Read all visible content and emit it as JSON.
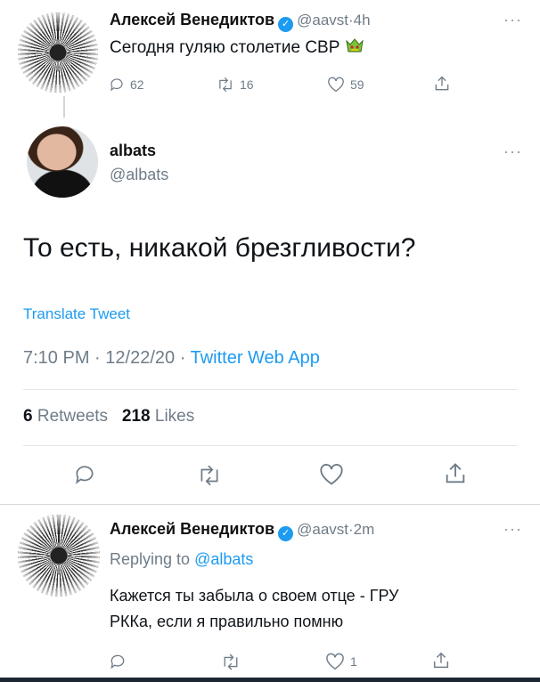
{
  "tweet1": {
    "author_name": "Алексей Венедиктов",
    "handle": "@aavst",
    "time": "4h",
    "text": "Сегодня гуляю столетие СВР",
    "replies": "62",
    "retweets": "16",
    "likes": "59"
  },
  "tweet2": {
    "author_name": "albats",
    "handle": "@albats",
    "text": "То есть, никакой брезгливости?",
    "translate": "Translate Tweet",
    "time": "7:10 PM",
    "date": "12/22/20",
    "source": "Twitter Web App",
    "retweets_count": "6",
    "retweets_label": "Retweets",
    "likes_count": "218",
    "likes_label": "Likes"
  },
  "tweet3": {
    "author_name": "Алексей Венедиктов",
    "handle": "@aavst",
    "time": "2m",
    "replying_prefix": "Replying to",
    "replying_to": "@albats",
    "text_line1": "Кажется ты забыла о своем отце - ГРУ",
    "text_line2": "РККа, если я правильно помню",
    "likes": "1"
  },
  "separator": "·",
  "more": "···",
  "colors": {
    "accent": "#1d9bf0",
    "muted": "#6f7c88",
    "divider": "#e3e6e8"
  },
  "icons": [
    "reply-icon",
    "retweet-icon",
    "like-icon",
    "share-icon",
    "verified-icon",
    "more-icon",
    "emoji-icon"
  ]
}
